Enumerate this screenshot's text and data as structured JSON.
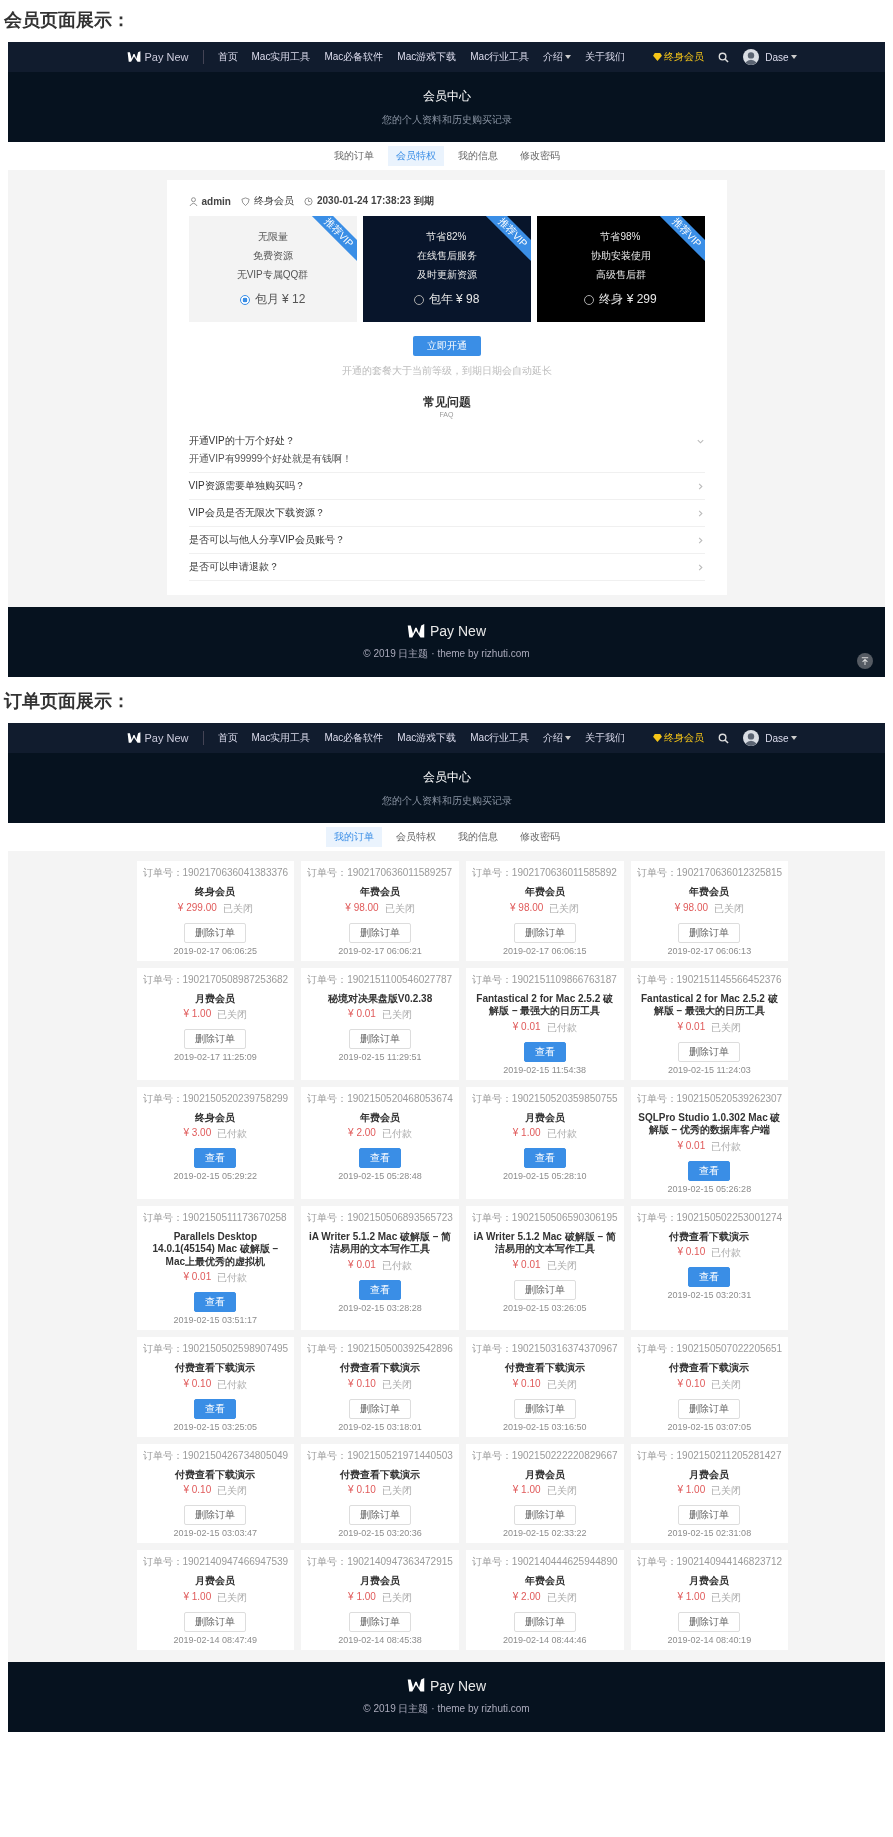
{
  "pages": [
    {
      "kind": "membership",
      "heading": "会员页面展示：",
      "nav": {
        "brand": "Pay New",
        "items": [
          {
            "label": "首页",
            "dropdown": false
          },
          {
            "label": "Mac实用工具",
            "dropdown": false
          },
          {
            "label": "Mac必备软件",
            "dropdown": false
          },
          {
            "label": "Mac游戏下载",
            "dropdown": false
          },
          {
            "label": "Mac行业工具",
            "dropdown": false
          },
          {
            "label": "介绍",
            "dropdown": true
          },
          {
            "label": "关于我们",
            "dropdown": false
          }
        ],
        "vip_label": "终身会员",
        "user_name": "Dase"
      },
      "hero": {
        "title": "会员中心",
        "subtitle": "您的个人资料和历史购买记录"
      },
      "tabs": [
        {
          "label": "我的订单",
          "selected": false
        },
        {
          "label": "会员特权",
          "selected": true
        },
        {
          "label": "我的信息",
          "selected": false
        },
        {
          "label": "修改密码",
          "selected": false
        }
      ],
      "user": {
        "name": "admin",
        "level": "终身会员",
        "expiry": "2030-01-24 17:38:23 到期"
      },
      "plans": [
        {
          "kind": "light",
          "ribbon": "推荐VIP",
          "features": [
            "无限量",
            "免费资源",
            "无VIP专属QQ群"
          ],
          "option": "包月 ¥ 12",
          "selected": true
        },
        {
          "kind": "navy",
          "ribbon": "推荐VIP",
          "features": [
            "节省82%",
            "在线售后服务",
            "及时更新资源"
          ],
          "option": "包年 ¥ 98",
          "selected": false
        },
        {
          "kind": "black",
          "ribbon": "推荐VIP",
          "features": [
            "节省98%",
            "协助安装使用",
            "高级售后群"
          ],
          "option": "终身 ¥ 299",
          "selected": false
        }
      ],
      "submit_button": "立即开通",
      "note": "开通的套餐大于当前等级，到期日期会自动延长",
      "faq": {
        "title": "常见问题",
        "subtitle": "FAQ",
        "items": [
          {
            "question": "开通VIP的十万个好处？",
            "answer": "开通VIP有99999个好处就是有钱啊！",
            "expanded": true
          },
          {
            "question": "VIP资源需要单独购买吗？",
            "expanded": false
          },
          {
            "question": "VIP会员是否无限次下载资源？",
            "expanded": false
          },
          {
            "question": "是否可以与他人分享VIP会员账号？",
            "expanded": false
          },
          {
            "question": "是否可以申请退款？",
            "expanded": false
          }
        ]
      },
      "footer": {
        "brand": "Pay New",
        "copyright": "© 2019 日主题 · theme by rizhuti.com",
        "back_to_top": true
      }
    },
    {
      "kind": "orders",
      "heading": "订单页面展示：",
      "nav": {
        "brand": "Pay New",
        "items": [
          {
            "label": "首页",
            "dropdown": false
          },
          {
            "label": "Mac实用工具",
            "dropdown": false
          },
          {
            "label": "Mac必备软件",
            "dropdown": false
          },
          {
            "label": "Mac游戏下载",
            "dropdown": false
          },
          {
            "label": "Mac行业工具",
            "dropdown": false
          },
          {
            "label": "介绍",
            "dropdown": true
          },
          {
            "label": "关于我们",
            "dropdown": false
          }
        ],
        "vip_label": "终身会员",
        "user_name": "Dase"
      },
      "hero": {
        "title": "会员中心",
        "subtitle": "您的个人资料和历史购买记录"
      },
      "tabs": [
        {
          "label": "我的订单",
          "selected": true
        },
        {
          "label": "会员特权",
          "selected": false
        },
        {
          "label": "我的信息",
          "selected": false
        },
        {
          "label": "修改密码",
          "selected": false
        }
      ],
      "orders": [
        {
          "order_no": "订单号：1902170636041383376",
          "title": "终身会员",
          "price": "¥ 299.00",
          "status": "已关闭",
          "kind": "closed",
          "button": "删除订单",
          "date": "2019-02-17 06:06:25"
        },
        {
          "order_no": "订单号：1902170636011589257",
          "title": "年费会员",
          "price": "¥ 98.00",
          "status": "已关闭",
          "kind": "closed",
          "button": "删除订单",
          "date": "2019-02-17 06:06:21"
        },
        {
          "order_no": "订单号：1902170636011585892",
          "title": "年费会员",
          "price": "¥ 98.00",
          "status": "已关闭",
          "kind": "closed",
          "button": "删除订单",
          "date": "2019-02-17 06:06:15"
        },
        {
          "order_no": "订单号：1902170636012325815",
          "title": "年费会员",
          "price": "¥ 98.00",
          "status": "已关闭",
          "kind": "closed",
          "button": "删除订单",
          "date": "2019-02-17 06:06:13"
        },
        {
          "order_no": "订单号：1902170508987253682",
          "title": "月费会员",
          "price": "¥ 1.00",
          "status": "已关闭",
          "kind": "closed",
          "button": "删除订单",
          "date": "2019-02-17 11:25:09"
        },
        {
          "order_no": "订单号：1902151100546027787",
          "title": "秘境对决果盘版V0.2.38",
          "price": "¥ 0.01",
          "status": "已关闭",
          "kind": "closed",
          "button": "删除订单",
          "date": "2019-02-15 11:29:51"
        },
        {
          "order_no": "订单号：1902151109866763187",
          "title": "Fantastical 2 for Mac 2.5.2 破解版 – 最强大的日历工具",
          "price": "¥ 0.01",
          "status": "已付款",
          "kind": "paid",
          "button": "查看",
          "date": "2019-02-15 11:54:38"
        },
        {
          "order_no": "订单号：1902151145566452376",
          "title": "Fantastical 2 for Mac 2.5.2 破解版 – 最强大的日历工具",
          "price": "¥ 0.01",
          "status": "已关闭",
          "kind": "closed",
          "button": "删除订单",
          "date": "2019-02-15 11:24:03"
        },
        {
          "order_no": "订单号：1902150520239758299",
          "title": "终身会员",
          "price": "¥ 3.00",
          "status": "已付款",
          "kind": "paid",
          "button": "查看",
          "date": "2019-02-15 05:29:22"
        },
        {
          "order_no": "订单号：1902150520468053674",
          "title": "年费会员",
          "price": "¥ 2.00",
          "status": "已付款",
          "kind": "paid",
          "button": "查看",
          "date": "2019-02-15 05:28:48"
        },
        {
          "order_no": "订单号：1902150520359850755",
          "title": "月费会员",
          "price": "¥ 1.00",
          "status": "已付款",
          "kind": "paid",
          "button": "查看",
          "date": "2019-02-15 05:28:10"
        },
        {
          "order_no": "订单号：1902150520539262307",
          "title": "SQLPro Studio 1.0.302 Mac 破解版 – 优秀的数据库客户端",
          "price": "¥ 0.01",
          "status": "已付款",
          "kind": "paid",
          "button": "查看",
          "date": "2019-02-15 05:26:28"
        },
        {
          "order_no": "订单号：1902150511173670258",
          "title": "Parallels Desktop 14.0.1(45154) Mac 破解版 – Mac上最优秀的虚拟机",
          "price": "¥ 0.01",
          "status": "已付款",
          "kind": "paid",
          "button": "查看",
          "date": "2019-02-15 03:51:17"
        },
        {
          "order_no": "订单号：1902150506893565723",
          "title": "iA Writer 5.1.2 Mac 破解版 – 简洁易用的文本写作工具",
          "price": "¥ 0.01",
          "status": "已付款",
          "kind": "paid",
          "button": "查看",
          "date": "2019-02-15 03:28:28"
        },
        {
          "order_no": "订单号：1902150506590306195",
          "title": "iA Writer 5.1.2 Mac 破解版 – 简洁易用的文本写作工具",
          "price": "¥ 0.01",
          "status": "已关闭",
          "kind": "closed",
          "button": "删除订单",
          "date": "2019-02-15 03:26:05"
        },
        {
          "order_no": "订单号：1902150502253001274",
          "title": "付费查看下载演示",
          "price": "¥ 0.10",
          "status": "已付款",
          "kind": "paid",
          "button": "查看",
          "date": "2019-02-15 03:20:31"
        },
        {
          "order_no": "订单号：1902150502598907495",
          "title": "付费查看下载演示",
          "price": "¥ 0.10",
          "status": "已付款",
          "kind": "paid",
          "button": "查看",
          "date": "2019-02-15 03:25:05"
        },
        {
          "order_no": "订单号：1902150500392542896",
          "title": "付费查看下载演示",
          "price": "¥ 0.10",
          "status": "已关闭",
          "kind": "closed",
          "button": "删除订单",
          "date": "2019-02-15 03:18:01"
        },
        {
          "order_no": "订单号：1902150316374370967",
          "title": "付费查看下载演示",
          "price": "¥ 0.10",
          "status": "已关闭",
          "kind": "closed",
          "button": "删除订单",
          "date": "2019-02-15 03:16:50"
        },
        {
          "order_no": "订单号：1902150507022205651",
          "title": "付费查看下载演示",
          "price": "¥ 0.10",
          "status": "已关闭",
          "kind": "closed",
          "button": "删除订单",
          "date": "2019-02-15 03:07:05"
        },
        {
          "order_no": "订单号：1902150426734805049",
          "title": "付费查看下载演示",
          "price": "¥ 0.10",
          "status": "已关闭",
          "kind": "closed",
          "button": "删除订单",
          "date": "2019-02-15 03:03:47"
        },
        {
          "order_no": "订单号：1902150521971440503",
          "title": "付费查看下载演示",
          "price": "¥ 0.10",
          "status": "已关闭",
          "kind": "closed",
          "button": "删除订单",
          "date": "2019-02-15 03:20:36"
        },
        {
          "order_no": "订单号：1902150222220829667",
          "title": "月费会员",
          "price": "¥ 1.00",
          "status": "已关闭",
          "kind": "closed",
          "button": "删除订单",
          "date": "2019-02-15 02:33:22"
        },
        {
          "order_no": "订单号：1902150211205281427",
          "title": "月费会员",
          "price": "¥ 1.00",
          "status": "已关闭",
          "kind": "closed",
          "button": "删除订单",
          "date": "2019-02-15 02:31:08"
        },
        {
          "order_no": "订单号：1902140947466947539",
          "title": "月费会员",
          "price": "¥ 1.00",
          "status": "已关闭",
          "kind": "closed",
          "button": "删除订单",
          "date": "2019-02-14 08:47:49"
        },
        {
          "order_no": "订单号：1902140947363472915",
          "title": "月费会员",
          "price": "¥ 1.00",
          "status": "已关闭",
          "kind": "closed",
          "button": "删除订单",
          "date": "2019-02-14 08:45:38"
        },
        {
          "order_no": "订单号：1902140444625944890",
          "title": "年费会员",
          "price": "¥ 2.00",
          "status": "已关闭",
          "kind": "closed",
          "button": "删除订单",
          "date": "2019-02-14 08:44:46"
        },
        {
          "order_no": "订单号：1902140944146823712",
          "title": "月费会员",
          "price": "¥ 1.00",
          "status": "已关闭",
          "kind": "closed",
          "button": "删除订单",
          "date": "2019-02-14 08:40:19"
        }
      ],
      "footer": {
        "brand": "Pay New",
        "copyright": "© 2019 日主题 · theme by rizhuti.com",
        "back_to_top": false
      }
    }
  ]
}
